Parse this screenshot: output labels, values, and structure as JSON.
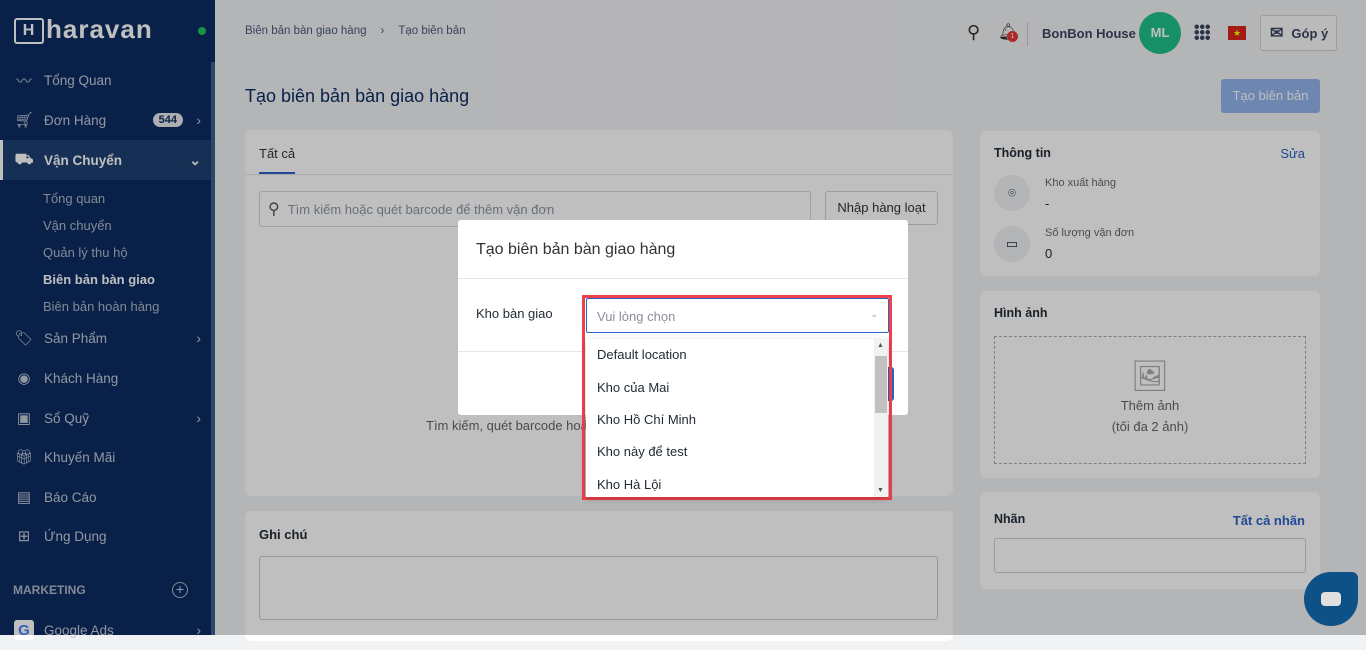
{
  "brand": {
    "name": "haravan"
  },
  "sidebar": {
    "items": [
      {
        "label": "Tổng Quan",
        "icon": "chart-line-icon"
      },
      {
        "label": "Đơn Hàng",
        "icon": "cart-icon",
        "badge": "544"
      },
      {
        "label": "Vận Chuyển",
        "icon": "truck-icon"
      },
      {
        "label": "Sản Phẩm",
        "icon": "tag-icon"
      },
      {
        "label": "Khách Hàng",
        "icon": "user-circle-icon"
      },
      {
        "label": "Sổ Quỹ",
        "icon": "cashbook-icon"
      },
      {
        "label": "Khuyến Mãi",
        "icon": "gift-icon"
      },
      {
        "label": "Báo Cáo",
        "icon": "report-icon"
      },
      {
        "label": "Ứng Dụng",
        "icon": "apps-icon"
      }
    ],
    "sub": [
      "Tổng quan",
      "Vận chuyển",
      "Quản lý thu hộ",
      "Biên bản bàn giao",
      "Biên bản hoàn hàng"
    ],
    "marketing": "MARKETING",
    "google": "Google Ads"
  },
  "header": {
    "breadcrumb": [
      "Biên bản bàn giao hàng",
      "Tạo biên bản"
    ],
    "notif": "1",
    "store": "BonBon House",
    "avatar": "ML",
    "feedback": "Góp ý"
  },
  "page": {
    "title": "Tạo biên bản bàn giao hàng",
    "create": "Tạo biên bản"
  },
  "tabs": {
    "all": "Tất cả"
  },
  "search": {
    "placeholder": "Tìm kiếm hoặc quét barcode để thêm vận đơn",
    "import": "Nhập hàng loạt",
    "empty": "Tìm kiếm, quét barcode hoặ"
  },
  "note": {
    "title": "Ghi chú"
  },
  "info": {
    "title": "Thông tin",
    "edit": "Sửa",
    "warehouse_label": "Kho xuất hàng",
    "warehouse_value": "-",
    "count_label": "Số lượng vận đơn",
    "count_value": "0"
  },
  "images": {
    "title": "Hình ảnh",
    "add": "Thêm ảnh",
    "limit": "(tối đa 2 ảnh)"
  },
  "tags": {
    "title": "Nhãn",
    "all": "Tất cả nhãn"
  },
  "modal": {
    "title": "Tạo biên bản bàn giao hàng",
    "field": "Kho bàn giao",
    "placeholder": "Vui lòng chọn",
    "options": [
      "Default location",
      "Kho của Mai",
      "Kho Hồ Chí Minh",
      "Kho này để test",
      "Kho Hà Lội"
    ]
  },
  "colors": {
    "accent": "#2a62c9",
    "highlight": "#f0404a",
    "sidebar": "#0c2d62"
  }
}
